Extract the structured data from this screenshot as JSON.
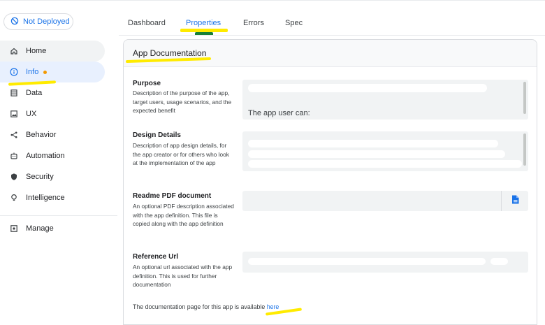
{
  "deploy_status": {
    "label": "Not Deployed",
    "icon": "not-deployed-icon"
  },
  "sidebar": {
    "items": [
      {
        "label": "Home",
        "icon": "home-icon"
      },
      {
        "label": "Info",
        "icon": "info-icon",
        "has_alert_dot": true
      },
      {
        "label": "Data",
        "icon": "data-table-icon"
      },
      {
        "label": "UX",
        "icon": "ux-image-icon"
      },
      {
        "label": "Behavior",
        "icon": "behavior-share-icon"
      },
      {
        "label": "Automation",
        "icon": "automation-robot-icon"
      },
      {
        "label": "Security",
        "icon": "shield-icon"
      },
      {
        "label": "Intelligence",
        "icon": "lightbulb-icon"
      },
      {
        "label": "Manage",
        "icon": "manage-icon"
      }
    ],
    "active_index": 1
  },
  "tabs": [
    {
      "label": "Dashboard"
    },
    {
      "label": "Properties"
    },
    {
      "label": "Errors"
    },
    {
      "label": "Spec"
    }
  ],
  "active_tab": "Properties",
  "card": {
    "title": "App Documentation",
    "fields": [
      {
        "title": "Purpose",
        "description": "Description of the purpose of the app, target users, usage scenarios, and the expected benefit",
        "visible_text": "The app user can:"
      },
      {
        "title": "Design Details",
        "description": "Description of app design details, for the app creator or for others who look at the implementation of the app"
      },
      {
        "title": "Readme PDF document",
        "description": "An optional PDF description associated with the app definition. This file is copied along with the app definition",
        "button_icon": "file-icon"
      },
      {
        "title": "Reference Url",
        "description": "An optional url associated with the app definition. This is used for further documentation"
      }
    ],
    "footer": {
      "text": "The documentation page for this app is available ",
      "link": "here"
    }
  },
  "colors": {
    "accent": "#1a73e8",
    "highlight": "#ffeb00",
    "alert_dot": "#f29900"
  }
}
